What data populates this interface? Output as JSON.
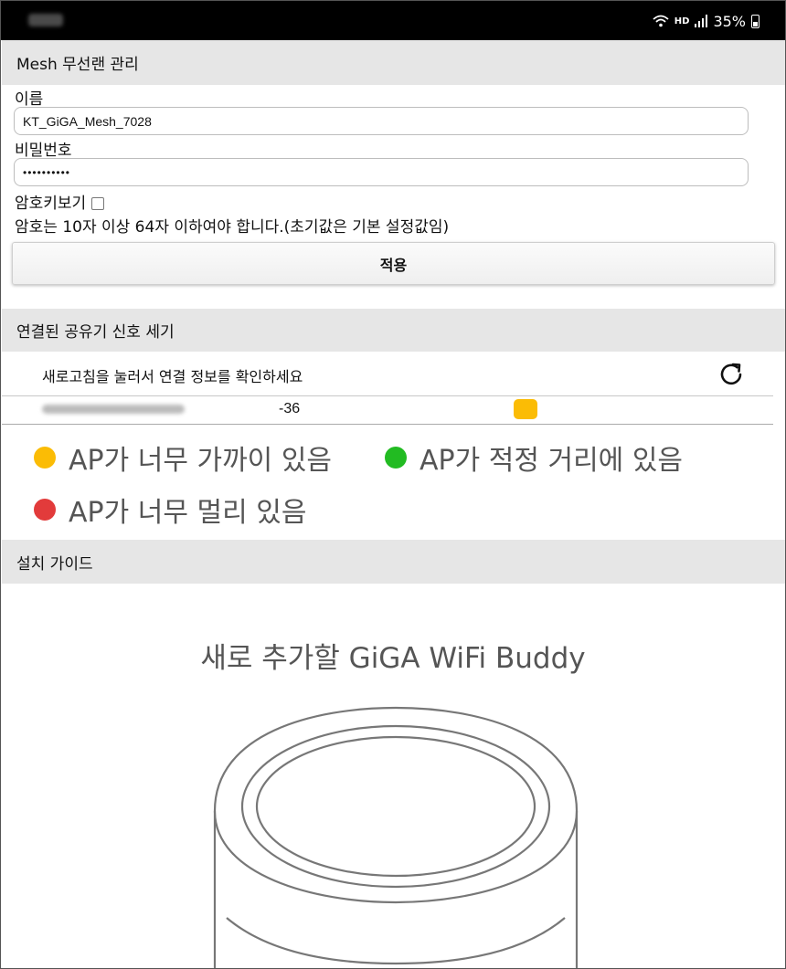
{
  "status_bar": {
    "signal_label": "HD",
    "battery": "35%"
  },
  "mesh_section": {
    "header": "Mesh 무선랜 관리",
    "name_label": "이름",
    "name_value": "KT_GiGA_Mesh_7028",
    "password_label": "비밀번호",
    "password_value": "••••••••••",
    "show_password_label": "암호키보기",
    "password_rule": "암호는 10자 이상 64자 이하여야 합니다.(초기값은 기본 설정값임)",
    "apply_button": "적용"
  },
  "signal_section": {
    "header": "연결된 공유기 신호 세기",
    "refresh_hint": "새로고침을 눌러서 연결 정보를 확인하세요",
    "rows": [
      {
        "rssi": "-36",
        "status_color": "#fbbc05"
      }
    ]
  },
  "legend": [
    {
      "label": "AP가 너무 가까이 있음",
      "color": "#fbbc05"
    },
    {
      "label": "AP가 적정 거리에 있음",
      "color": "#22bb22"
    },
    {
      "label": "AP가 너무 멀리 있음",
      "color": "#e23b3b"
    }
  ],
  "guide_section": {
    "header": "설치 가이드",
    "title": "새로 추가할 GiGA WiFi Buddy"
  },
  "icons": {
    "refresh": "refresh-icon",
    "wifi": "wifi-icon",
    "cell_signal": "cell-signal-icon",
    "battery": "battery-icon"
  }
}
